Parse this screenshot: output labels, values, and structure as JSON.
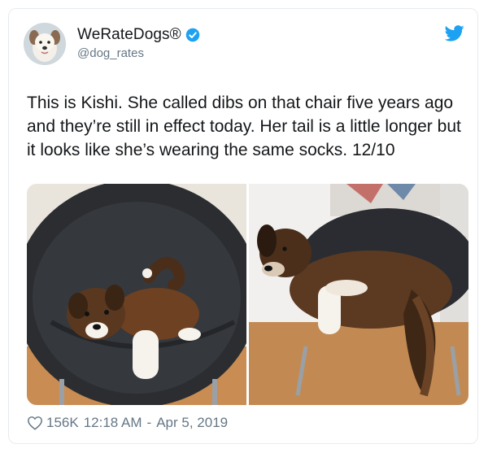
{
  "account": {
    "display_name": "WeRateDogs®",
    "handle": "@dog_rates",
    "verified": true
  },
  "tweet": {
    "text": "This is Kishi. She called dibs on that chair five years ago and they’re still in effect today. Her tail is a little longer but it looks like she’s wearing the same socks. 12/10"
  },
  "media": [
    {
      "description_icon": "puppy-on-chair-photo"
    },
    {
      "description_icon": "adult-dog-on-chair-photo"
    }
  ],
  "footer": {
    "likes": "156K",
    "time": "12:18 AM",
    "separator": "-",
    "date": "Apr 5, 2019"
  },
  "colors": {
    "accent": "#1da1f2",
    "text": "#14171a",
    "muted": "#657786"
  }
}
